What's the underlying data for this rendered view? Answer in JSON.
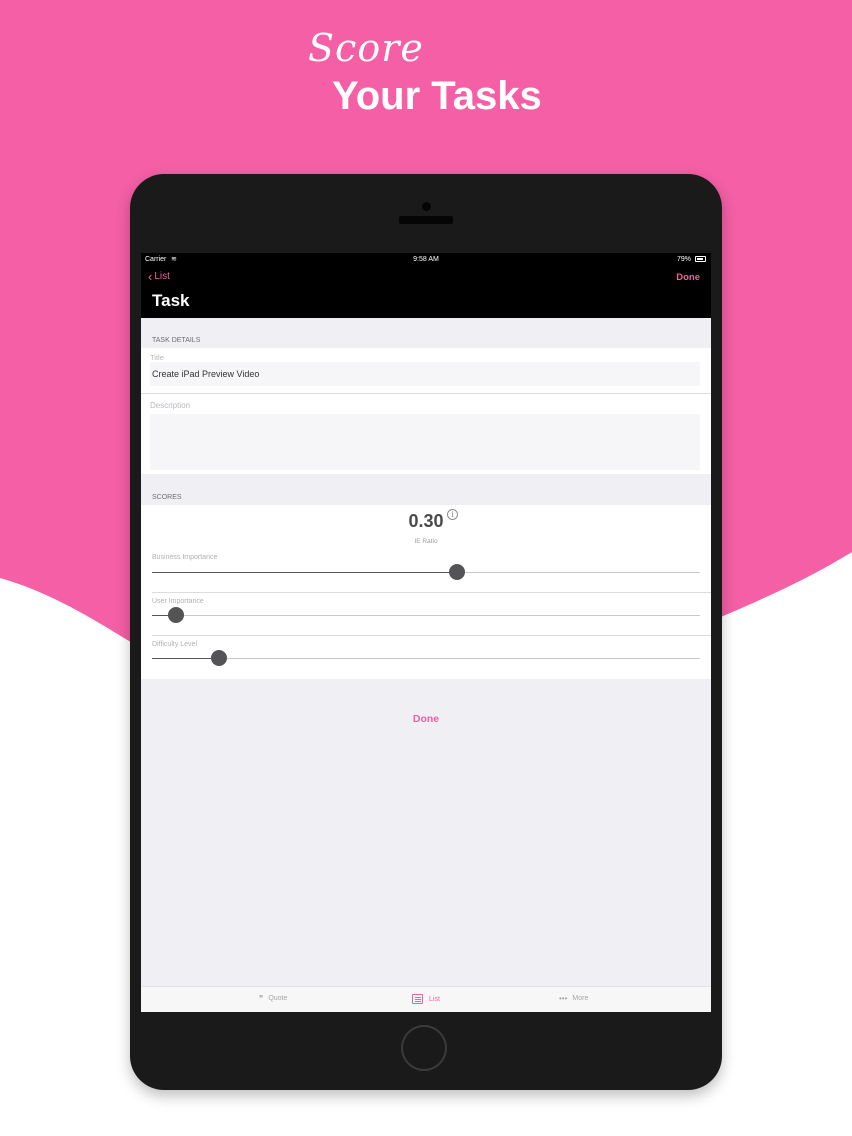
{
  "headline": {
    "line1": "Score",
    "line2": "Your Tasks"
  },
  "colors": {
    "brand_pink": "#f45fa5",
    "accent": "#f2609e",
    "device": "#1b1a1b"
  },
  "status_bar": {
    "carrier": "Carrier",
    "wifi_icon": "wifi-icon",
    "time": "9:58 AM",
    "battery": "79%"
  },
  "nav": {
    "back_label": "List",
    "done_label": "Done",
    "title": "Task"
  },
  "task_details": {
    "header": "TASK DETAILS",
    "title_label": "Title",
    "title_value": "Create iPad Preview Video",
    "description_placeholder": "Description"
  },
  "scores": {
    "header": "SCORES",
    "ie_value": "0.30",
    "ie_label": "IE Ratio",
    "sliders": [
      {
        "label": "Business Importance",
        "value_fraction": 0.556
      },
      {
        "label": "User Importance",
        "value_fraction": 0.043
      },
      {
        "label": "Difficulty Level",
        "value_fraction": 0.122
      }
    ]
  },
  "done_button": "Done",
  "tabs": [
    {
      "label": "Quote",
      "icon": "quote-icon",
      "active": false
    },
    {
      "label": "List",
      "icon": "list-icon",
      "active": true
    },
    {
      "label": "More",
      "icon": "more-icon",
      "active": false
    }
  ]
}
